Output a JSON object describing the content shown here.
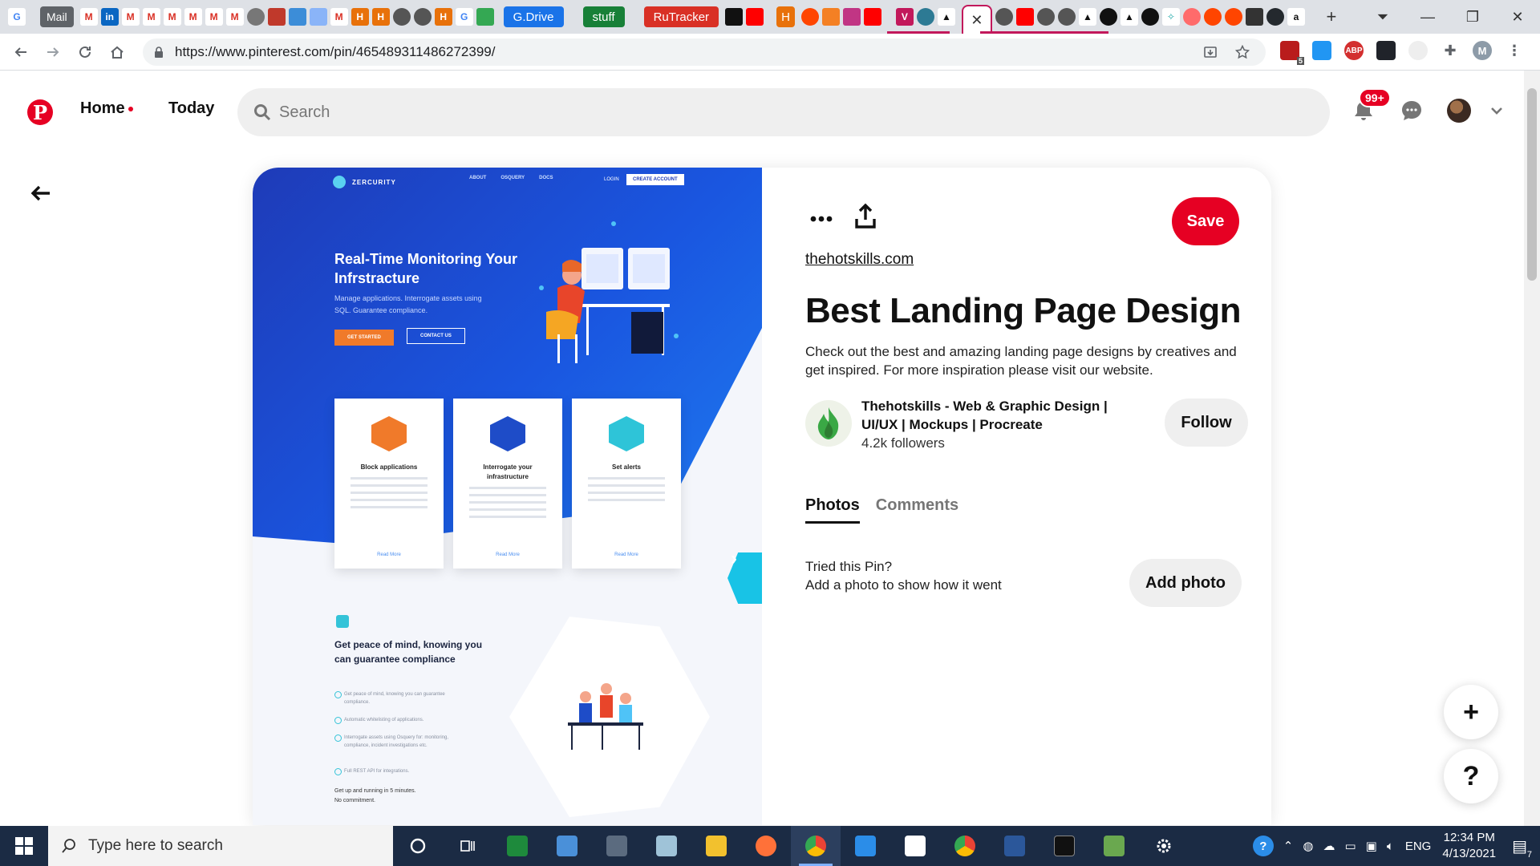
{
  "browser": {
    "tabs": {
      "mail_label": "Mail",
      "gdrive_label": "G.Drive",
      "stuff_label": "stuff",
      "rutracker_label": "RuTracker",
      "h_label": "H",
      "v_label": "V",
      "amazon_label": "a",
      "new_tab_symbol": "+"
    },
    "colors": {
      "tab_group_accent": "#c2185b",
      "gdrive": "#1a73e8",
      "stuff": "#188038",
      "rutracker": "#d93025",
      "h_tab": "#e8710a"
    },
    "url": "https://www.pinterest.com/pin/465489311486272399/",
    "profile_initial": "M",
    "ext_badge": "5",
    "abp_label": "ABP"
  },
  "pinterest": {
    "nav": {
      "home": "Home",
      "today": "Today"
    },
    "search_placeholder": "Search",
    "notifications_badge": "99+",
    "brand_color": "#e60023",
    "pin": {
      "source": "thehotskills.com",
      "title": "Best Landing Page Design",
      "description": "Check out the best and amazing landing page designs by creatives and get inspired. For more inspiration please visit our website.",
      "save_label": "Save",
      "creator": {
        "name": "Thehotskills - Web & Graphic Design | UI/UX | Mockups | Procreate",
        "followers": "4.2k followers",
        "follow_label": "Follow"
      },
      "tabs": [
        "Photos",
        "Comments"
      ],
      "tried_title": "Tried this Pin?",
      "tried_sub": "Add a photo to show how it went",
      "add_photo_label": "Add photo"
    },
    "image": {
      "brand": "ZERCURITY",
      "nav_links": [
        "ABOUT",
        "OSQUERY",
        "DOCS"
      ],
      "login": "LOGIN",
      "create_account": "CREATE ACCOUNT",
      "hero_title": "Real-Time Monitoring Your Infrstracture",
      "hero_sub": "Manage applications. Interrogate assets using SQL. Guarantee compliance.",
      "get_started": "GET STARTED",
      "contact_us": "CONTACT US",
      "cards": [
        {
          "title": "Block applications",
          "more": "Read More"
        },
        {
          "title": "Interrogate your infrastructure",
          "more": "Read More"
        },
        {
          "title": "Set alerts",
          "more": "Read More"
        }
      ],
      "section_title": "Get peace of mind, knowing you can guarantee compliance",
      "checks": [
        "Get peace of mind, knowing you can guarantee compliance.",
        "Automatic whitelisting of applications.",
        "Interrogate assets using Osquery for: monitoring, compliance, incident investigations etc.",
        "Full REST API for integrations."
      ],
      "footer_line1": "Get up and running in 5 minutes.",
      "footer_line2": "No commitment."
    },
    "fab_plus": "+",
    "fab_help": "?"
  },
  "taskbar": {
    "search_placeholder": "Type here to search",
    "language": "ENG",
    "time": "12:34 PM",
    "date": "4/13/2021",
    "notification_count": "7"
  }
}
